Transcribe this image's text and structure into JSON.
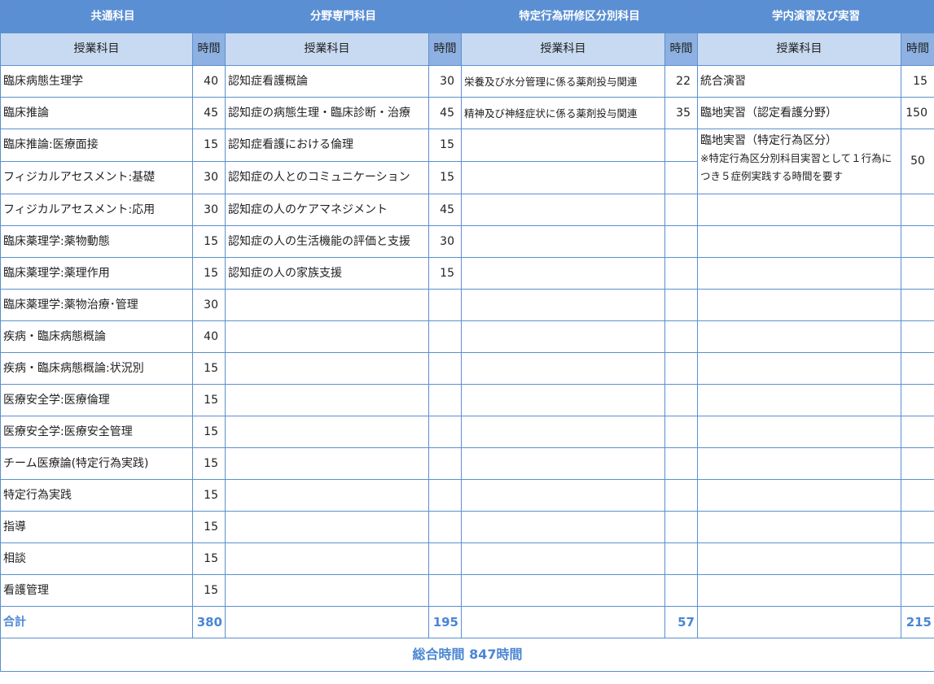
{
  "headers": {
    "common": "共通科目",
    "specialty": "分野専門科目",
    "specific": "特定行為研修区分別科目",
    "practice": "学内演習及び実習",
    "subject_label": "授業科目",
    "hours_label": "時間"
  },
  "common": [
    {
      "subject": "臨床病態生理学",
      "hours": "40"
    },
    {
      "subject": "臨床推論",
      "hours": "45"
    },
    {
      "subject": "臨床推論:医療面接",
      "hours": "15"
    },
    {
      "subject": "フィジカルアセスメント:基礎",
      "hours": "30"
    },
    {
      "subject": "フィジカルアセスメント:応用",
      "hours": "30"
    },
    {
      "subject": "臨床薬理学:薬物動態",
      "hours": "15"
    },
    {
      "subject": "臨床薬理学:薬理作用",
      "hours": "15"
    },
    {
      "subject": "臨床薬理学:薬物治療･管理",
      "hours": "30"
    },
    {
      "subject": "疾病・臨床病態概論",
      "hours": "40"
    },
    {
      "subject": "疾病・臨床病態概論:状況別",
      "hours": "15"
    },
    {
      "subject": "医療安全学:医療倫理",
      "hours": "15"
    },
    {
      "subject": "医療安全学:医療安全管理",
      "hours": "15"
    },
    {
      "subject": "チーム医療論(特定行為実践)",
      "hours": "15"
    },
    {
      "subject": "特定行為実践",
      "hours": "15"
    },
    {
      "subject": "指導",
      "hours": "15"
    },
    {
      "subject": "相談",
      "hours": "15"
    },
    {
      "subject": "看護管理",
      "hours": "15"
    }
  ],
  "specialty": [
    {
      "subject": "認知症看護概論",
      "hours": "30"
    },
    {
      "subject": "認知症の病態生理・臨床診断・治療",
      "hours": "45"
    },
    {
      "subject": "認知症看護における倫理",
      "hours": "15"
    },
    {
      "subject": "認知症の人とのコミュニケーション",
      "hours": "15"
    },
    {
      "subject": "認知症の人のケアマネジメント",
      "hours": "45"
    },
    {
      "subject": "認知症の人の生活機能の評価と支援",
      "hours": "30"
    },
    {
      "subject": "認知症の人の家族支援",
      "hours": "15"
    }
  ],
  "specific": [
    {
      "subject": "栄養及び水分管理に係る薬剤投与関連",
      "hours": "22"
    },
    {
      "subject": "精神及び神経症状に係る薬剤投与関連",
      "hours": "35"
    }
  ],
  "practice": [
    {
      "subject": "統合演習",
      "hours": "15"
    },
    {
      "subject": "臨地実習（認定看護分野）",
      "hours": "150"
    },
    {
      "subject": "臨地実習（特定行為区分）",
      "note": "※特定行為区分別科目実習として１行為につき５症例実践する時間を要す",
      "hours": "50"
    }
  ],
  "totals": {
    "label": "合計",
    "common": "380",
    "specialty": "195",
    "specific": "57",
    "practice": "215"
  },
  "grand_total": "総合時間 847時間",
  "colors": {
    "header_bg": "#5b8fd3",
    "subheader_bg": "#c7daf1",
    "hours_header_bg": "#8cb1e2",
    "border": "#5b8fd0",
    "total_text": "#4a86d4"
  }
}
